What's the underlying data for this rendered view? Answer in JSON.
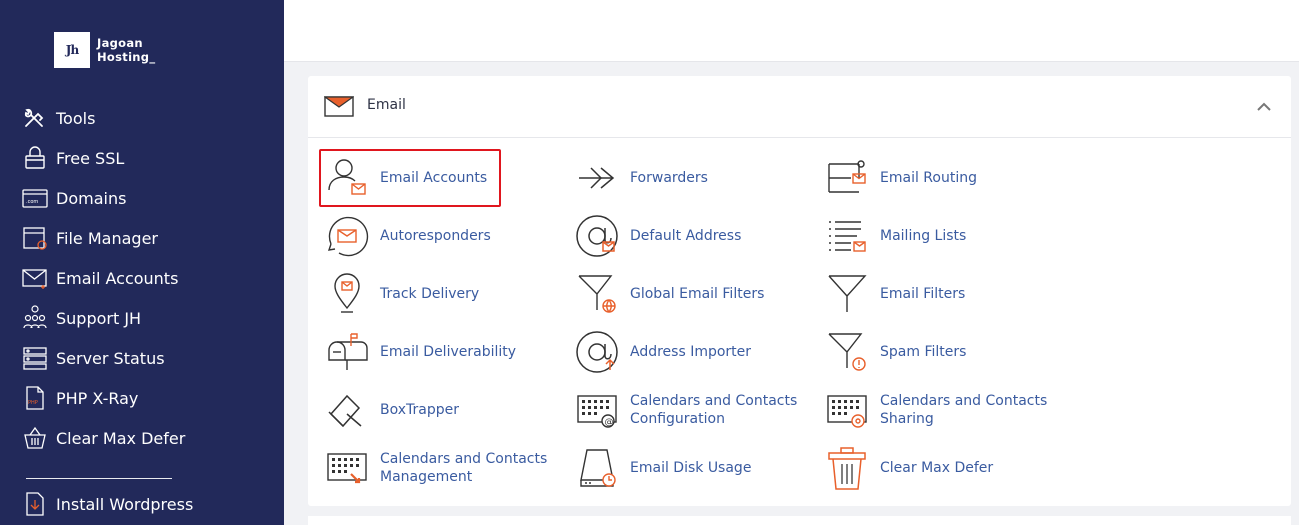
{
  "brand": {
    "logo_mark": "Jh",
    "name_line1": "Jagoan",
    "name_line2": "Hosting_"
  },
  "sidebar": {
    "items": [
      {
        "label": "Tools",
        "icon": "tools-icon"
      },
      {
        "label": "Free SSL",
        "icon": "lock-icon"
      },
      {
        "label": "Domains",
        "icon": "domain-icon"
      },
      {
        "label": "File Manager",
        "icon": "file-manager-icon"
      },
      {
        "label": "Email Accounts",
        "icon": "email-icon"
      },
      {
        "label": "Support JH",
        "icon": "support-icon"
      },
      {
        "label": "Server Status",
        "icon": "server-icon"
      },
      {
        "label": "PHP X-Ray",
        "icon": "php-file-icon"
      },
      {
        "label": "Clear Max Defer",
        "icon": "basket-icon"
      },
      {
        "label": "Install Wordpress",
        "icon": "download-file-icon"
      }
    ]
  },
  "panel": {
    "title": "Email",
    "tiles": [
      {
        "label": "Email Accounts",
        "icon": "email-accounts-icon"
      },
      {
        "label": "Forwarders",
        "icon": "forwarders-icon"
      },
      {
        "label": "Email Routing",
        "icon": "email-routing-icon"
      },
      {
        "label": "Autoresponders",
        "icon": "autoresponders-icon"
      },
      {
        "label": "Default Address",
        "icon": "at-sign-icon"
      },
      {
        "label": "Mailing Lists",
        "icon": "mailing-lists-icon"
      },
      {
        "label": "Track Delivery",
        "icon": "map-pin-icon"
      },
      {
        "label": "Global Email Filters",
        "icon": "global-filter-icon"
      },
      {
        "label": "Email Filters",
        "icon": "funnel-icon"
      },
      {
        "label": "Email Deliverability",
        "icon": "mailbox-icon"
      },
      {
        "label": "Address Importer",
        "icon": "address-importer-icon"
      },
      {
        "label": "Spam Filters",
        "icon": "spam-filter-icon"
      },
      {
        "label": "BoxTrapper",
        "icon": "boxtrapper-icon"
      },
      {
        "label": "Calendars and Contacts Configuration",
        "icon": "calendar-config-icon"
      },
      {
        "label": "Calendars and Contacts Sharing",
        "icon": "calendar-share-icon"
      },
      {
        "label": "Calendars and Contacts Management",
        "icon": "calendar-manage-icon"
      },
      {
        "label": "Email Disk Usage",
        "icon": "disk-usage-icon"
      },
      {
        "label": "Clear Max Defer",
        "icon": "trash-icon"
      }
    ]
  },
  "colors": {
    "sidebar_bg": "#22295a",
    "link": "#3a5ba0",
    "accent": "#e8602c",
    "highlight_border": "#e0161e"
  }
}
